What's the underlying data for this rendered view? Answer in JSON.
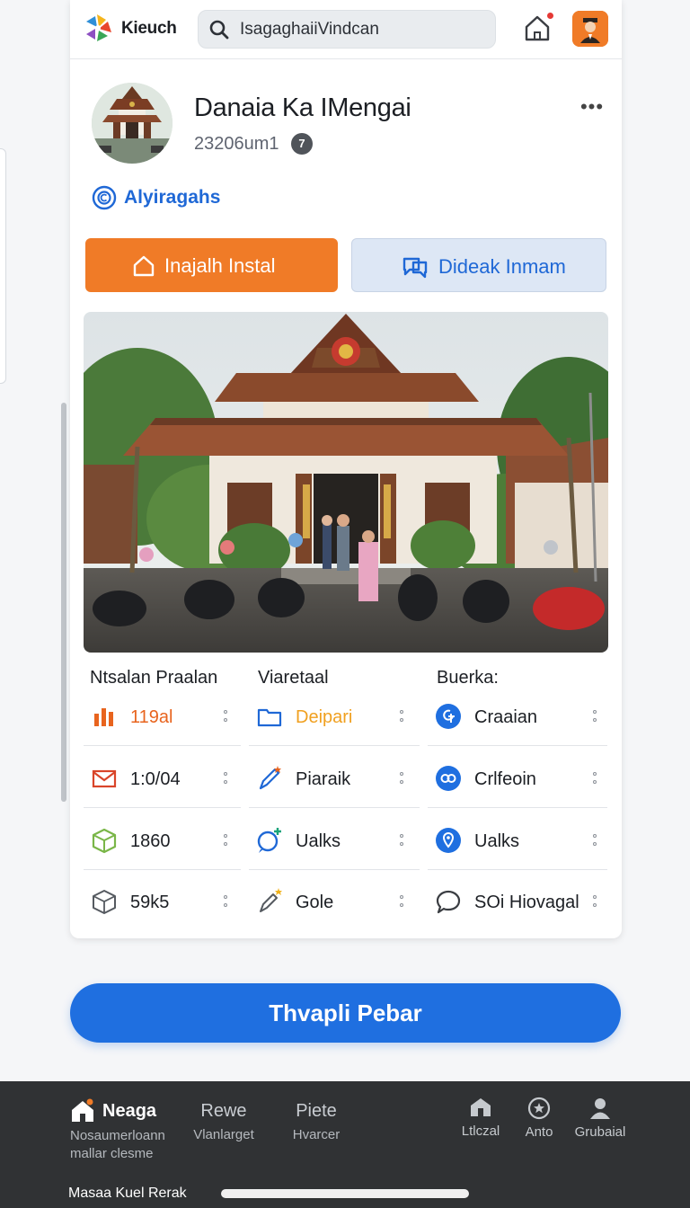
{
  "topbar": {
    "brand": "Kieuch",
    "search_value": "IsagaghaiiVindcan"
  },
  "profile": {
    "name": "Danaia Ka IMengai",
    "meta": "23206um1",
    "badge": "7",
    "verified_label": "Alyiragahs"
  },
  "actions": {
    "primary": "Inajalh Instal",
    "secondary": "Dideak Inmam"
  },
  "stats": {
    "columns": [
      {
        "title": "Ntsalan Praalan",
        "rows": [
          {
            "value": "119al",
            "icon": "bar-chart-icon",
            "color": "#e8641e"
          },
          {
            "value": "1:0/04",
            "icon": "mail-icon",
            "color": "#333a45"
          },
          {
            "value": "1860",
            "icon": "cube-icon",
            "color": "#333a45"
          },
          {
            "value": "59k5",
            "icon": "box-icon",
            "color": "#333a45"
          }
        ]
      },
      {
        "title": "Viaretaal",
        "rows": [
          {
            "value": "Deipari",
            "icon": "folder-icon",
            "color": "#f0a020"
          },
          {
            "value": "Piaraik",
            "icon": "pen-icon",
            "color": "#1c1f24"
          },
          {
            "value": "Ualks",
            "icon": "chat-plus-icon",
            "color": "#1c1f24"
          },
          {
            "value": "Gole",
            "icon": "pen-star-icon",
            "color": "#1c1f24"
          }
        ]
      },
      {
        "title": "Buerka:",
        "rows": [
          {
            "value": "Craaian",
            "icon": "circle-info-icon",
            "color": "#1c1f24"
          },
          {
            "value": "Crlfeoin",
            "icon": "circle-link-icon",
            "color": "#1c1f24"
          },
          {
            "value": "Ualks",
            "icon": "pin-icon",
            "color": "#1c1f24"
          },
          {
            "value": "SOi Hiovagal",
            "icon": "speech-icon",
            "color": "#1c1f24"
          }
        ]
      }
    ]
  },
  "cta_label": "Thvapli Pebar",
  "bottom_nav": {
    "home": {
      "label": "Neaga",
      "sub1": "Nosaumerloann",
      "sub2": "mallar clesme"
    },
    "review": {
      "label": "Rewe",
      "sub": "Vlanlarget"
    },
    "piere": {
      "label": "Piete",
      "sub": "Hvarcer"
    },
    "local": "Ltlczal",
    "anto": "Anto",
    "global": "Grubaial"
  },
  "bottom_caption": "Masaa Kuel Rerak",
  "colors": {
    "accent_orange": "#f07b27",
    "accent_blue": "#1f6fe0",
    "nav_bg": "#303234"
  }
}
